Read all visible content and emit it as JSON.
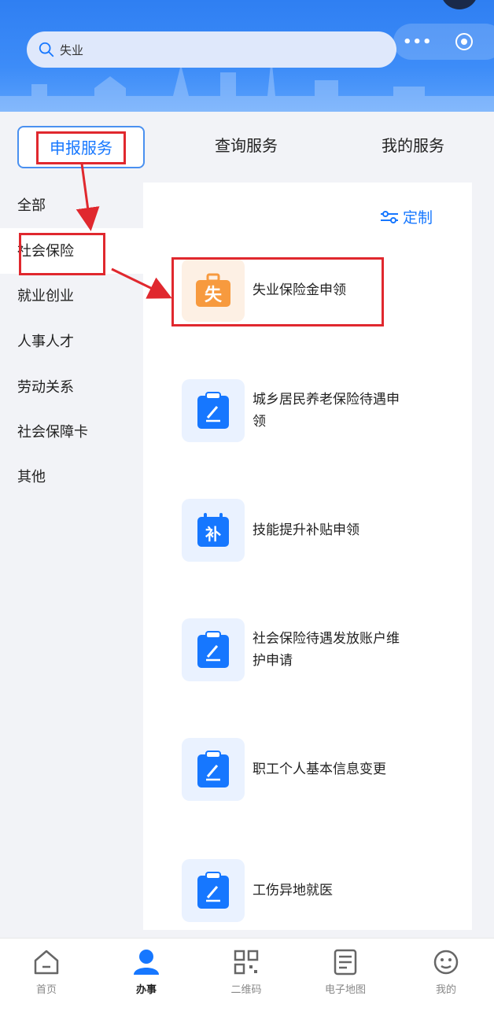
{
  "search": {
    "value": "失业"
  },
  "tabs": [
    {
      "label": "申报服务"
    },
    {
      "label": "查询服务"
    },
    {
      "label": "我的服务"
    }
  ],
  "sidebar": {
    "items": [
      {
        "label": "全部"
      },
      {
        "label": "社会保险"
      },
      {
        "label": "就业创业"
      },
      {
        "label": "人事人才"
      },
      {
        "label": "劳动关系"
      },
      {
        "label": "社会保障卡"
      },
      {
        "label": "其他"
      }
    ]
  },
  "panel": {
    "custom_label": "定制",
    "services": [
      {
        "label": "失业保险金申领",
        "icon": "briefcase-icon",
        "icon_text": "失"
      },
      {
        "label": "城乡居民养老保险待遇申领",
        "icon": "clipboard-edit-icon"
      },
      {
        "label": "技能提升补贴申领",
        "icon": "calendar-subsidy-icon",
        "icon_text": "补"
      },
      {
        "label": "社会保险待遇发放账户维护申请",
        "icon": "clipboard-edit-icon"
      },
      {
        "label": "职工个人基本信息变更",
        "icon": "clipboard-edit-icon"
      },
      {
        "label": "工伤异地就医",
        "icon": "clipboard-edit-icon"
      }
    ]
  },
  "bottom_nav": [
    {
      "label": "首页",
      "icon": "home-icon"
    },
    {
      "label": "办事",
      "icon": "person-icon"
    },
    {
      "label": "二维码",
      "icon": "qrcode-icon"
    },
    {
      "label": "电子地图",
      "icon": "map-doc-icon"
    },
    {
      "label": "我的",
      "icon": "smile-icon"
    }
  ],
  "colors": {
    "accent": "#1677ff",
    "highlight": "#e0282e",
    "orange": "#f79a3e"
  }
}
